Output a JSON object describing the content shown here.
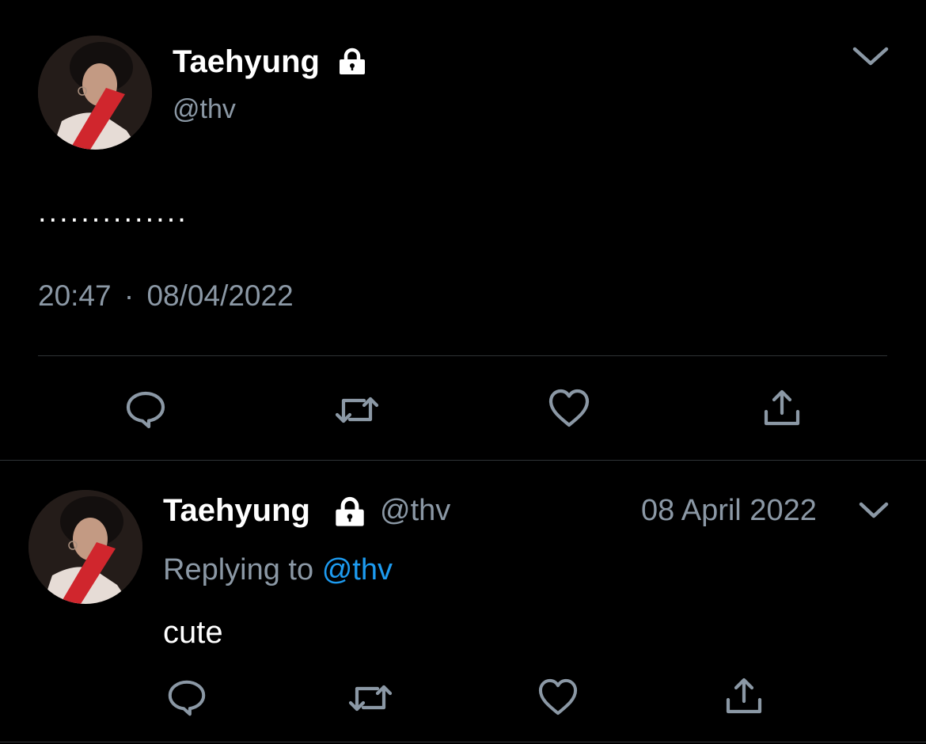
{
  "main_tweet": {
    "display_name": "Taehyung",
    "handle": "@thv",
    "text": "..............",
    "time": "20:47",
    "separator": "·",
    "date": "08/04/2022",
    "icons": {
      "lock": "lock-icon",
      "menu": "chevron-down-icon",
      "actions": [
        "reply-icon",
        "retweet-icon",
        "like-icon",
        "share-icon"
      ]
    }
  },
  "reply_tweet": {
    "display_name": "Taehyung",
    "handle": "@thv",
    "date": "08 April 2022",
    "replying_prefix": "Replying to",
    "replying_handle": "@thv",
    "text": "cute",
    "icons": {
      "lock": "lock-icon",
      "menu": "chevron-down-icon",
      "actions": [
        "reply-icon",
        "retweet-icon",
        "like-icon",
        "share-icon"
      ]
    }
  },
  "colors": {
    "background": "#000000",
    "text_primary": "#ffffff",
    "text_secondary": "#8b98a5",
    "link": "#1d9bf0",
    "divider": "#2f3336"
  }
}
